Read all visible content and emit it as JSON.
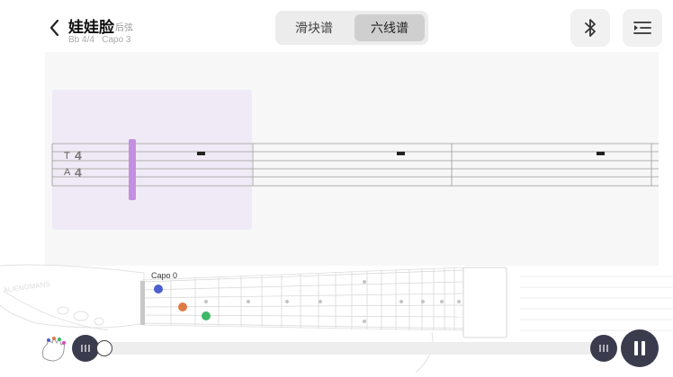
{
  "header": {
    "title": "娃娃脸",
    "subtitle": "后弦",
    "meta": "Bb 4/4   Capo 3"
  },
  "view_toggle": {
    "options": [
      {
        "label": "滑块谱",
        "active": false
      },
      {
        "label": "六线谱",
        "active": true
      }
    ]
  },
  "toolbar": {
    "icons": [
      "bluetooth-icon",
      "playlist-icon"
    ]
  },
  "tab": {
    "string_labels": [
      "T",
      "A"
    ],
    "time_signature": "4"
  },
  "fretboard": {
    "capo_label": "Capo 0",
    "finger_dot_colors": [
      "#4b5fd0",
      "#e07a45",
      "#3fb86a"
    ]
  },
  "colors": {
    "highlight": "#efeaf5",
    "cursor": "#c58fe0",
    "control_dark": "#3a3c4e"
  }
}
